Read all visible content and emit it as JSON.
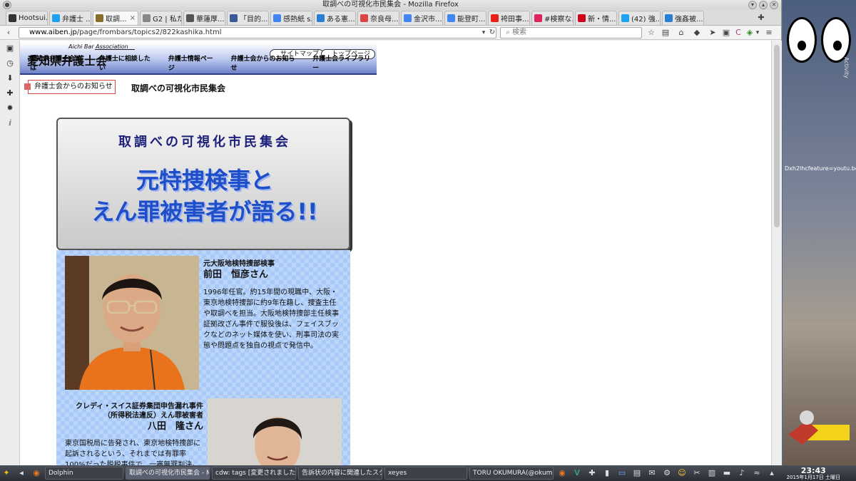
{
  "window": {
    "title": "取調べの可視化市民集会 - Mozilla Firefox"
  },
  "tabs": [
    {
      "label": "Hootsui...",
      "color": "#333333"
    },
    {
      "label": "弁護士 ...",
      "color": "#1da1f2"
    },
    {
      "label": "取調...",
      "color": "#8a6d2b",
      "active": true
    },
    {
      "label": "G2 | 私たち...",
      "color": "#888888"
    },
    {
      "label": "華蓮厚...",
      "color": "#555555"
    },
    {
      "label": "「目的...",
      "color": "#3b5998"
    },
    {
      "label": "感熱紙 s...",
      "color": "#4285f4"
    },
    {
      "label": "ある憲...",
      "color": "#2a7fd4"
    },
    {
      "label": "奈良母...",
      "color": "#dd4444"
    },
    {
      "label": "金沢市...",
      "color": "#4285f4"
    },
    {
      "label": "能登町...",
      "color": "#4285f4"
    },
    {
      "label": "袴田事...",
      "color": "#e62117"
    },
    {
      "label": "#検察な...",
      "color": "#e0245e"
    },
    {
      "label": "新・情...",
      "color": "#d0021b"
    },
    {
      "label": "(42) 強...",
      "color": "#1da1f2"
    },
    {
      "label": "強姦被...",
      "color": "#2a7fd4"
    }
  ],
  "nav": {
    "url_host": "www.aiben.jp",
    "url_path": "/page/frombars/topics2/822kashika.html",
    "search_placeholder": "検索"
  },
  "page": {
    "org_name": "愛知県弁護士会",
    "org_en": "Aichi Bar Association",
    "pill_sitemap": "サイトマップ",
    "pill_top": "トップページ",
    "menu": [
      "愛知県弁護士会とは",
      "弁護士に相談したい",
      "弁護士情報ページ",
      "弁護士会からのお知らせ",
      "弁護士会ライブラリー"
    ],
    "news_label": "弁護士会からのお知らせ",
    "heading": "取調べの可視化市民集会"
  },
  "flyer": {
    "title": "取調べの可視化市民集会",
    "headline_line1": "元特捜検事と",
    "headline_line2": "えん罪被害者が語る!!",
    "person1": {
      "title": "元大阪地検特捜部検事",
      "name": "前田　恒彦さん",
      "bio": "1996年任官。約15年間の現職中、大阪・東京地検特捜部に約9年在籍し、捜査主任や取調べを担当。大阪地検特捜部主任検事証拠改ざん事件で服役後は、フェイスブックなどのネット媒体を使い、刑事司法の実態や問題点を独自の視点で発信中。"
    },
    "person2": {
      "title_line1": "クレディ・スイス証券集団申告漏れ事件",
      "title_line2": "（所得税法違反）えん罪被害者",
      "name": "八田　隆さん",
      "bio": "東京国税局に告発され、東京地検特捜部に起訴されるという、それまでは有罪率100%だった脱税事件で、一審無罪判決。検察官控訴棄"
    }
  },
  "desktop": {
    "activity_label": "Activity",
    "clip_label": "Dxh2lhcfeature=youtu.be"
  },
  "taskbar": {
    "tasks": [
      "Dolphin",
      "取調べの可視化市民集会 - M",
      "cdw: tags [変更されました]",
      "告訴状の内容に関連したスク",
      "xeyes",
      "TORU OKUMURA(@okumu"
    ],
    "time": "23:43",
    "date": "2015年1月17日 土曜日"
  }
}
